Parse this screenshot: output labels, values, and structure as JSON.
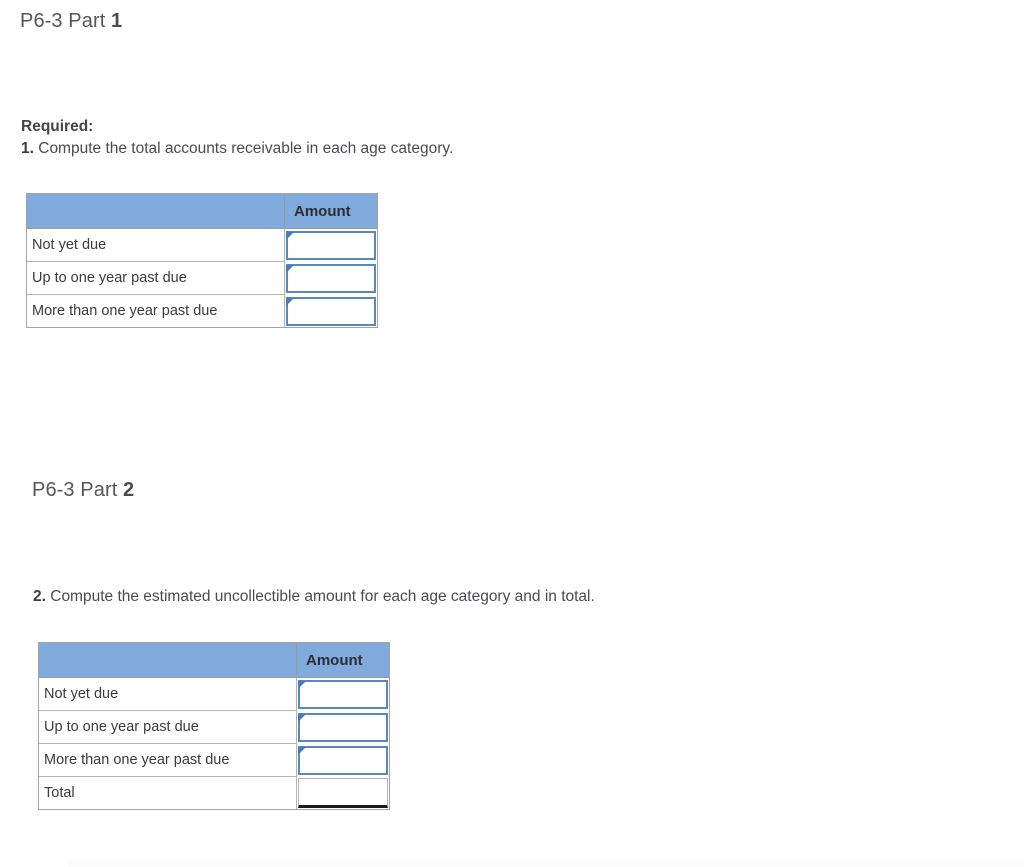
{
  "page": {
    "background_color": "#ffffff",
    "accent_header_color": "#81abdd",
    "input_border_color": "#5b87bf",
    "text_color": "#3f3f3f"
  },
  "part1": {
    "heading_prefix": "P6-3 Part ",
    "heading_number": "1",
    "required_label": "Required:",
    "instruction_number": "1.",
    "instruction_text": " Compute the total accounts receivable in each age category.",
    "table": {
      "headers": [
        "",
        "Amount"
      ],
      "rows": [
        {
          "label": "Not yet due",
          "amount": "",
          "input": true
        },
        {
          "label": "Up to one year past due",
          "amount": "",
          "input": true
        },
        {
          "label": "More than one year past due",
          "amount": "",
          "input": true
        }
      ]
    }
  },
  "part2": {
    "heading_prefix": "P6-3 Part ",
    "heading_number": "2",
    "instruction_number": "2.",
    "instruction_text": " Compute the estimated uncollectible amount for each age category and in total.",
    "table": {
      "headers": [
        "",
        "Amount"
      ],
      "rows": [
        {
          "label": "Not yet due",
          "amount": "",
          "input": true
        },
        {
          "label": "Up to one year past due",
          "amount": "",
          "input": true
        },
        {
          "label": "More than one year past due",
          "amount": "",
          "input": true
        },
        {
          "label": "Total",
          "amount": "",
          "input": false
        }
      ]
    }
  }
}
